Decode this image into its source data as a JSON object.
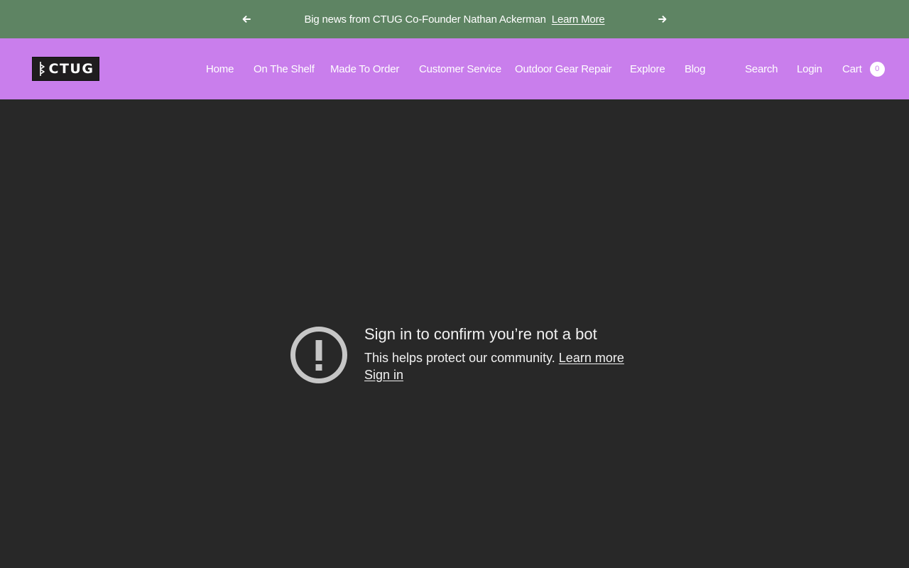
{
  "announcement": {
    "message": "Big news from CTUG Co-Founder Nathan Ackerman",
    "link": "Learn More",
    "prev_icon": "arrow-left-icon",
    "next_icon": "arrow-right-icon",
    "bg_color": "#5e8463"
  },
  "header": {
    "bg_color": "#c97eec",
    "logo_text": "CTUG",
    "nav": [
      {
        "label": "Home"
      },
      {
        "label": "On The Shelf"
      },
      {
        "label": "Made To Order"
      },
      {
        "label": "Customer Service"
      },
      {
        "label": "Outdoor Gear Repair"
      },
      {
        "label": "Explore"
      },
      {
        "label": "Blog"
      }
    ],
    "search_label": "Search",
    "login_label": "Login",
    "cart_label": "Cart",
    "cart_count": "0"
  },
  "main": {
    "bg_color": "#282828",
    "notice": {
      "icon": "exclamation-circle-icon",
      "title": "Sign in to confirm you’re not a bot",
      "description": "This helps protect our community.",
      "learn_more": "Learn more",
      "sign_in": "Sign in"
    }
  }
}
